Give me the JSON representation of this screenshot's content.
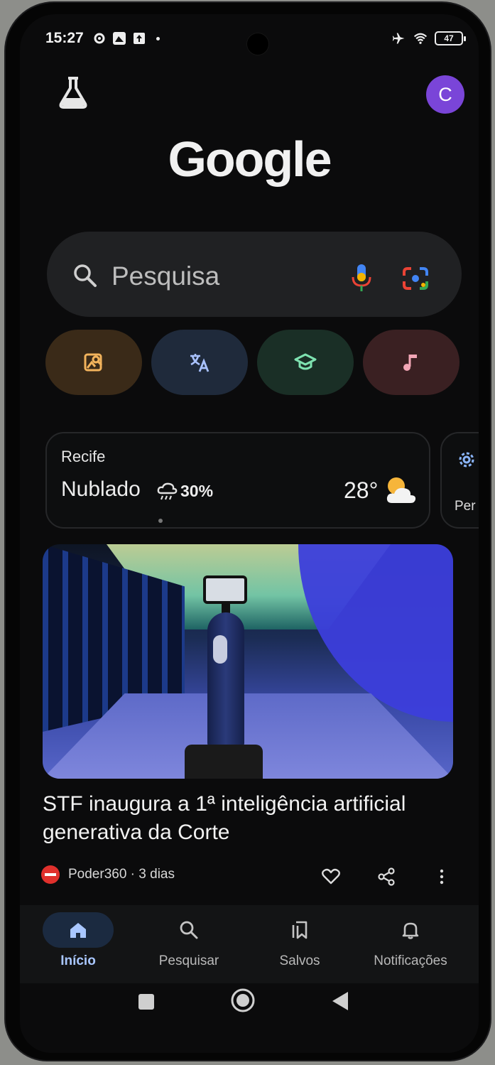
{
  "status_bar": {
    "time": "15:27",
    "battery": "47"
  },
  "header": {
    "avatar_initial": "C",
    "logo": "Google"
  },
  "search": {
    "placeholder": "Pesquisa"
  },
  "chips": [
    {
      "icon": "image-search-icon",
      "color": "#f2b35c",
      "bg": "#3a2a18"
    },
    {
      "icon": "translate-icon",
      "color": "#a9c2ff",
      "bg": "#1f2a3b"
    },
    {
      "icon": "school-icon",
      "color": "#7ee2b0",
      "bg": "#1a2f26"
    },
    {
      "icon": "music-note-icon",
      "color": "#f2a6b6",
      "bg": "#3a2022"
    }
  ],
  "weather": {
    "city": "Recife",
    "condition": "Nublado",
    "rain_chance": "30%",
    "temperature": "28°"
  },
  "side_card": {
    "label": "Per"
  },
  "news": {
    "headline": "STF inaugura a 1ª inteligência artificial generativa da Corte",
    "source": "Poder360 · 3 dias"
  },
  "bottom_nav": {
    "items": [
      {
        "label": "Início",
        "active": true
      },
      {
        "label": "Pesquisar",
        "active": false
      },
      {
        "label": "Salvos",
        "active": false
      },
      {
        "label": "Notificações",
        "active": false
      }
    ]
  },
  "colors": {
    "avatar": "#7a45d8",
    "nav_active": "#a9c7ff"
  }
}
